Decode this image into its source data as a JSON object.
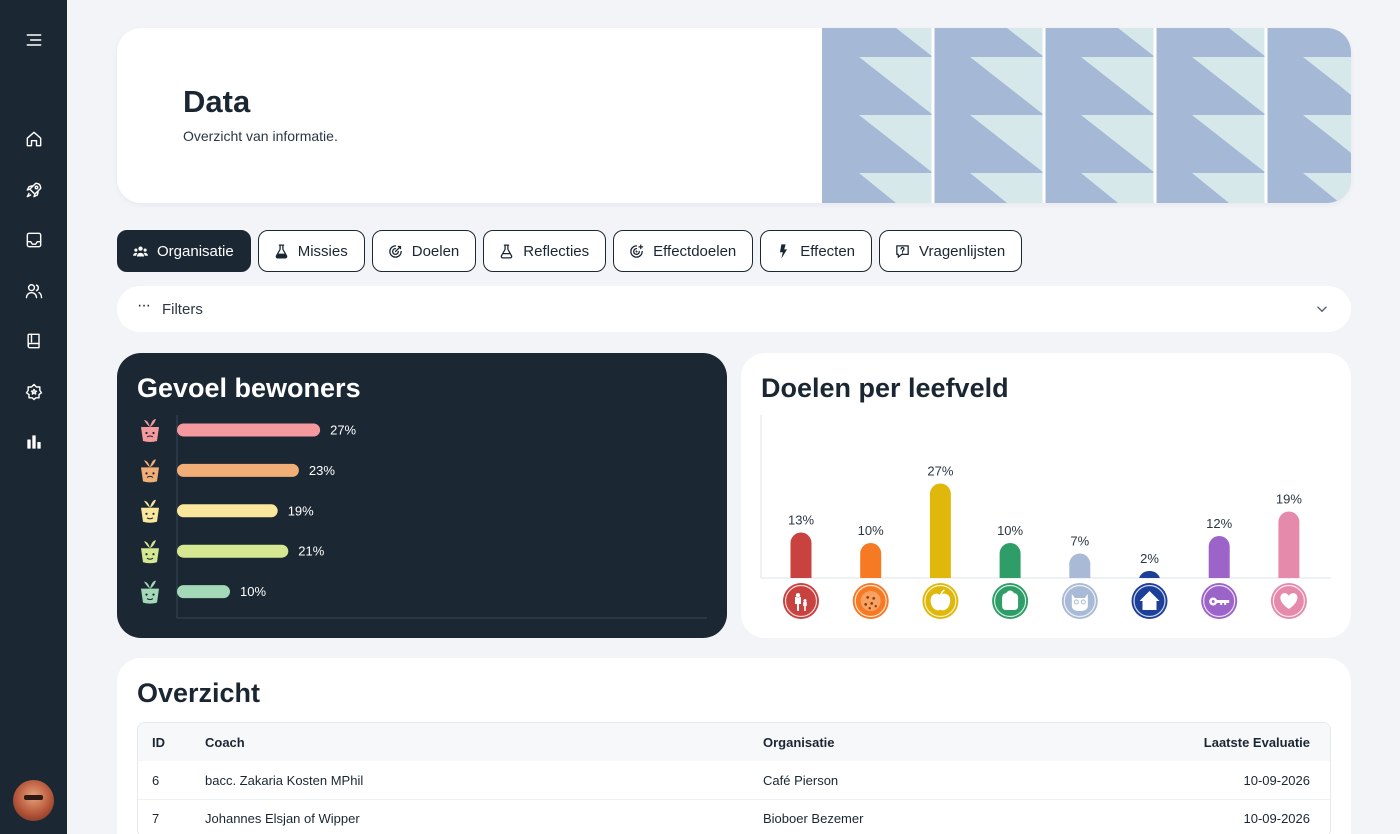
{
  "header": {
    "title": "Data",
    "subtitle": "Overzicht van informatie."
  },
  "sidebar": {
    "items": [
      {
        "icon": "menu-icon"
      },
      {
        "icon": "home-icon"
      },
      {
        "icon": "rocket-icon"
      },
      {
        "icon": "inbox-icon"
      },
      {
        "icon": "users-icon"
      },
      {
        "icon": "book-icon"
      },
      {
        "icon": "badge-icon"
      },
      {
        "icon": "bar-chart-icon",
        "active": true
      }
    ]
  },
  "tabs": [
    {
      "label": "Organisatie",
      "icon": "group-icon",
      "active": true
    },
    {
      "label": "Missies",
      "icon": "flask-icon"
    },
    {
      "label": "Doelen",
      "icon": "target-icon"
    },
    {
      "label": "Reflecties",
      "icon": "flask-icon"
    },
    {
      "label": "Effectdoelen",
      "icon": "target-plus-icon"
    },
    {
      "label": "Effecten",
      "icon": "bolt-icon"
    },
    {
      "label": "Vragenlijsten",
      "icon": "question-message-icon"
    }
  ],
  "filters": {
    "label": "Filters"
  },
  "charts": {
    "feeling": {
      "title": "Gevoel bewoners"
    },
    "goals": {
      "title": "Doelen per leefveld"
    }
  },
  "chart_data": [
    {
      "type": "bar",
      "orientation": "horizontal",
      "title": "Gevoel bewoners",
      "categories": [
        "plant-face-1",
        "plant-face-2",
        "plant-face-3",
        "plant-face-4",
        "plant-face-5"
      ],
      "values": [
        27,
        23,
        19,
        21,
        10
      ],
      "labels": [
        "27%",
        "23%",
        "19%",
        "21%",
        "10%"
      ],
      "colors": [
        "#f4999d",
        "#f2ae77",
        "#fbe79b",
        "#d5e891",
        "#a4d9b7"
      ],
      "max": 100
    },
    {
      "type": "bar",
      "orientation": "vertical",
      "title": "Doelen per leefveld",
      "categories": [
        "family-icon",
        "cookie-icon",
        "apple-icon",
        "wallet-icon",
        "owl-icon",
        "house-icon",
        "key-icon",
        "heart-icon"
      ],
      "values": [
        13,
        10,
        27,
        10,
        7,
        2,
        12,
        19
      ],
      "labels": [
        "13%",
        "10%",
        "27%",
        "10%",
        "7%",
        "2%",
        "12%",
        "19%"
      ],
      "colors": [
        "#c8423f",
        "#f57a23",
        "#e0b80b",
        "#2f9d68",
        "#a9bad6",
        "#1c3f9a",
        "#9c63c9",
        "#e68aab"
      ],
      "max": 30
    }
  ],
  "table": {
    "title": "Overzicht",
    "columns": [
      "ID",
      "Coach",
      "Organisatie",
      "Laatste Evaluatie"
    ],
    "rows": [
      [
        "6",
        "bacc. Zakaria Kosten MPhil",
        "Café Pierson",
        "10-09-2026"
      ],
      [
        "7",
        "Johannes Elsjan of Wipper",
        "Bioboer Bezemer",
        "10-09-2026"
      ]
    ]
  }
}
